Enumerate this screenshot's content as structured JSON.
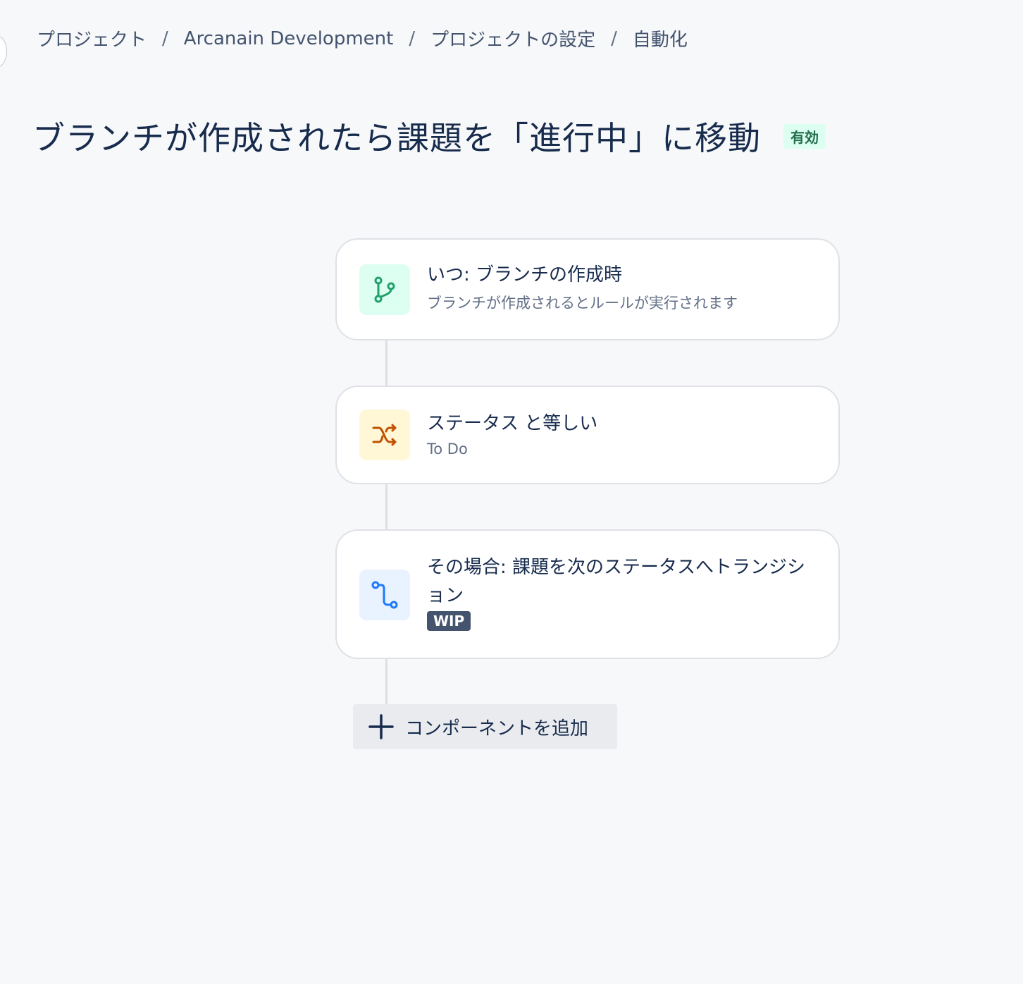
{
  "breadcrumb": {
    "items": [
      "プロジェクト",
      "Arcanain Development",
      "プロジェクトの設定",
      "自動化"
    ],
    "separator": "/"
  },
  "rule": {
    "title": "ブランチが作成されたら課題を「進行中」に移動",
    "status": "有効"
  },
  "components": [
    {
      "title": "いつ: ブランチの作成時",
      "subtitle": "ブランチが作成されるとルールが実行されます",
      "icon": "branch-icon",
      "icon_color": "#22a06b"
    },
    {
      "title": "ステータス と等しい",
      "subtitle": "To Do",
      "icon": "shuffle-icon",
      "icon_color": "#c25100"
    },
    {
      "title": "その場合: 課題を次のステータスへトランジション",
      "badge": "WIP",
      "icon": "transition-icon",
      "icon_color": "#1d7afc"
    }
  ],
  "add_component": {
    "label": "コンポーネントを追加",
    "icon": "plus-icon"
  }
}
